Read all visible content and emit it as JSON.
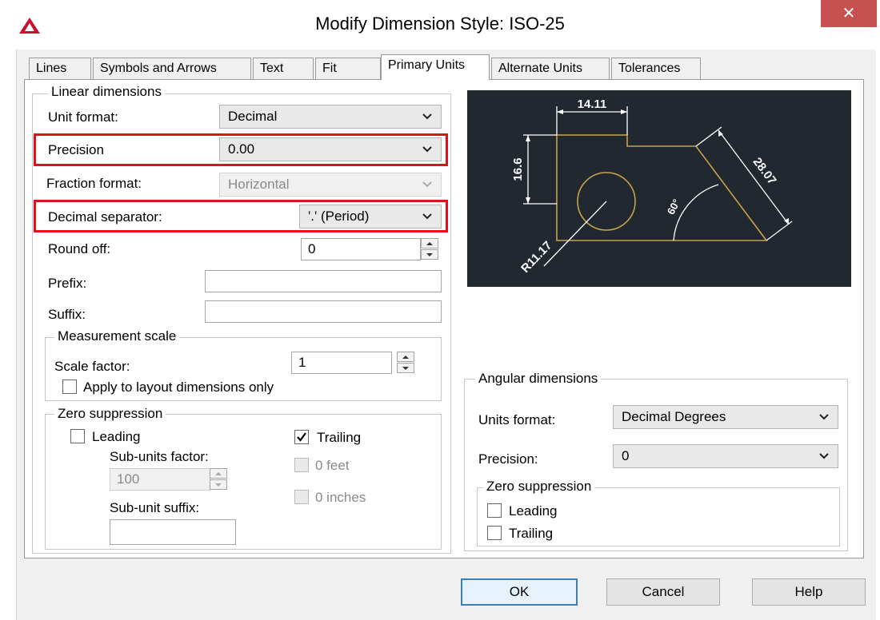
{
  "window": {
    "title": "Modify Dimension Style: ISO-25",
    "close_glyph": "✕"
  },
  "tabs": [
    {
      "label": "Lines"
    },
    {
      "label": "Symbols and Arrows"
    },
    {
      "label": "Text"
    },
    {
      "label": "Fit"
    },
    {
      "label": "Primary Units",
      "active": true
    },
    {
      "label": "Alternate Units"
    },
    {
      "label": "Tolerances"
    }
  ],
  "linear": {
    "legend": "Linear dimensions",
    "unit_format_label": "Unit format:",
    "unit_format_value": "Decimal",
    "precision_label": "Precision",
    "precision_value": "0.00",
    "fraction_format_label": "Fraction format:",
    "fraction_format_value": "Horizontal",
    "decimal_separator_label": "Decimal separator:",
    "decimal_separator_value": "'.' (Period)",
    "round_off_label": "Round off:",
    "round_off_value": "0",
    "prefix_label": "Prefix:",
    "prefix_value": "",
    "suffix_label": "Suffix:",
    "suffix_value": ""
  },
  "measurement": {
    "legend": "Measurement scale",
    "scale_factor_label": "Scale factor:",
    "scale_factor_value": "1",
    "apply_layout_label": "Apply to layout dimensions only",
    "apply_layout_checked": false
  },
  "zero_linear": {
    "legend": "Zero suppression",
    "leading_label": "Leading",
    "leading_checked": false,
    "trailing_label": "Trailing",
    "trailing_checked": true,
    "sub_units_factor_label": "Sub-units factor:",
    "sub_units_factor_value": "100",
    "feet_label": "0 feet",
    "inches_label": "0 inches",
    "sub_unit_suffix_label": "Sub-unit suffix:",
    "sub_unit_suffix_value": ""
  },
  "preview": {
    "dim_horizontal": "14.11",
    "dim_vertical": "16.6",
    "dim_aligned": "28.07",
    "dim_angle": "60°",
    "dim_radius": "R11.17"
  },
  "angular": {
    "legend": "Angular dimensions",
    "units_format_label": "Units format:",
    "units_format_value": "Decimal Degrees",
    "precision_label": "Precision:",
    "precision_value": "0",
    "zero_legend": "Zero suppression",
    "leading_label": "Leading",
    "leading_checked": false,
    "trailing_label": "Trailing",
    "trailing_checked": false
  },
  "buttons": {
    "ok": "OK",
    "cancel": "Cancel",
    "help": "Help"
  },
  "colors": {
    "highlight": "#e0101c",
    "preview_bg": "#212830",
    "geometry": "#c8a24a",
    "dimension": "#ffffff"
  }
}
